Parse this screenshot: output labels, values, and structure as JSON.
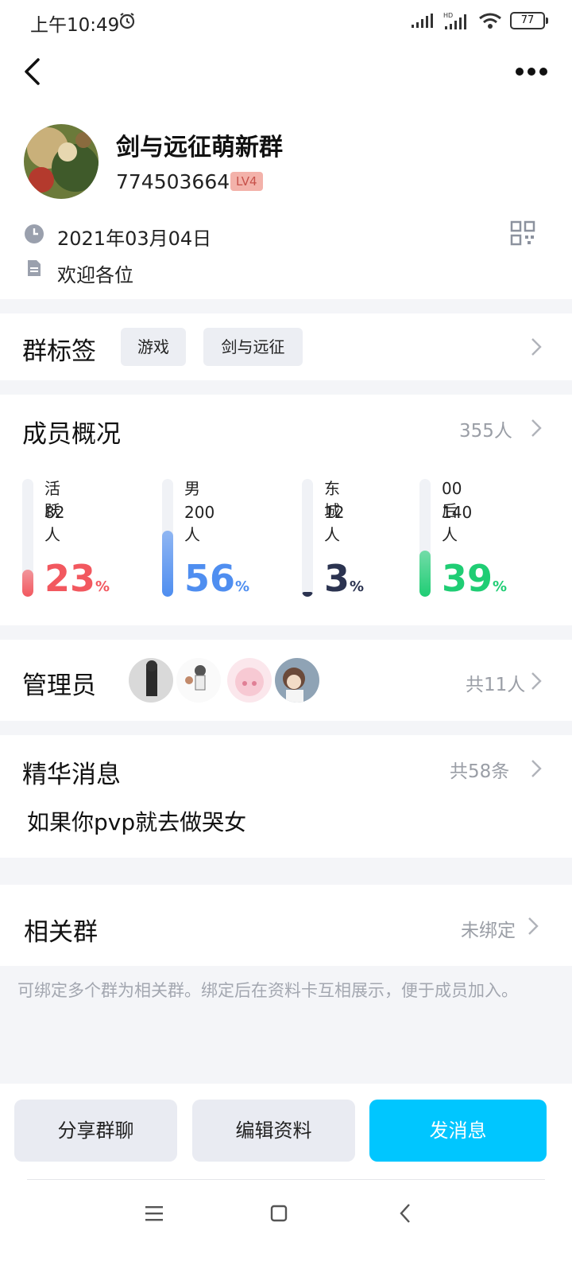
{
  "status_bar": {
    "time": "上午10:49",
    "battery": "77"
  },
  "group": {
    "name": "剑与远征萌新群",
    "id": "774503664",
    "level": "LV4",
    "date": "2021年03月04日",
    "intro": "欢迎各位"
  },
  "tags": {
    "title": "群标签",
    "items": [
      "游戏",
      "剑与远征"
    ]
  },
  "members": {
    "title": "成员概况",
    "total": "355人",
    "stats": [
      {
        "label": "活跃",
        "count": "82人",
        "percent": "23",
        "unit": "%",
        "fill": 0.23,
        "color": "#f2585f"
      },
      {
        "label": "男",
        "count": "200人",
        "percent": "56",
        "unit": "%",
        "fill": 0.56,
        "color": "#4f8ef0"
      },
      {
        "label": "东城",
        "count": "12人",
        "percent": "3",
        "unit": "%",
        "fill": 0.03,
        "color": "#2b3350"
      },
      {
        "label": "00后",
        "count": "140人",
        "percent": "39",
        "unit": "%",
        "fill": 0.39,
        "color": "#1fcd74"
      }
    ]
  },
  "admins": {
    "title": "管理员",
    "count": "共11人"
  },
  "essence": {
    "title": "精华消息",
    "count": "共58条",
    "message": "如果你pvp就去做哭女"
  },
  "related": {
    "title": "相关群",
    "status": "未绑定",
    "hint": "可绑定多个群为相关群。绑定后在资料卡互相展示，便于成员加入。"
  },
  "actions": {
    "share": "分享群聊",
    "edit": "编辑资料",
    "send": "发消息"
  },
  "colors": {
    "primary": "#00c6ff",
    "level_bg": "#f3b2aa"
  }
}
